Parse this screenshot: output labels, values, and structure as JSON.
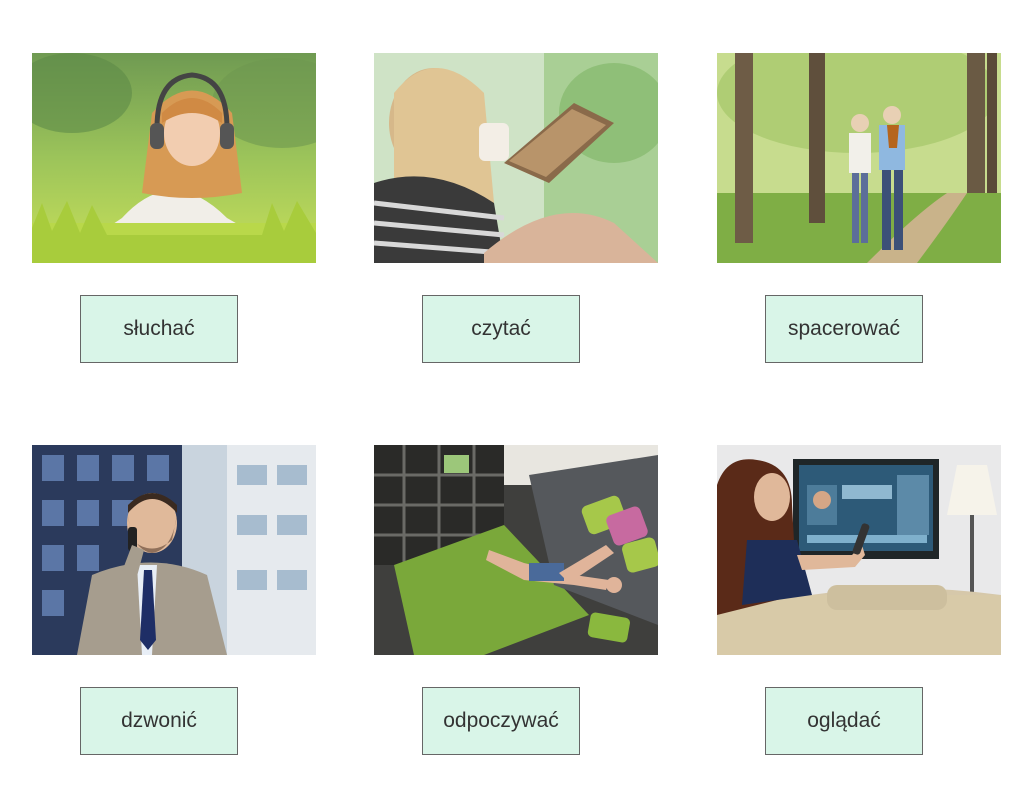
{
  "cards": [
    {
      "label": "słuchać",
      "image": "woman-with-headphones-on-grass"
    },
    {
      "label": "czytać",
      "image": "woman-reading-book"
    },
    {
      "label": "spacerować",
      "image": "elderly-couple-walking-in-park"
    },
    {
      "label": "dzwonić",
      "image": "man-on-phone"
    },
    {
      "label": "odpoczywać",
      "image": "woman-resting-on-rug"
    },
    {
      "label": "oglądać",
      "image": "woman-watching-tv"
    }
  ],
  "colors": {
    "label_background": "#d9f5e8",
    "label_border": "#666666",
    "label_text": "#333333"
  }
}
